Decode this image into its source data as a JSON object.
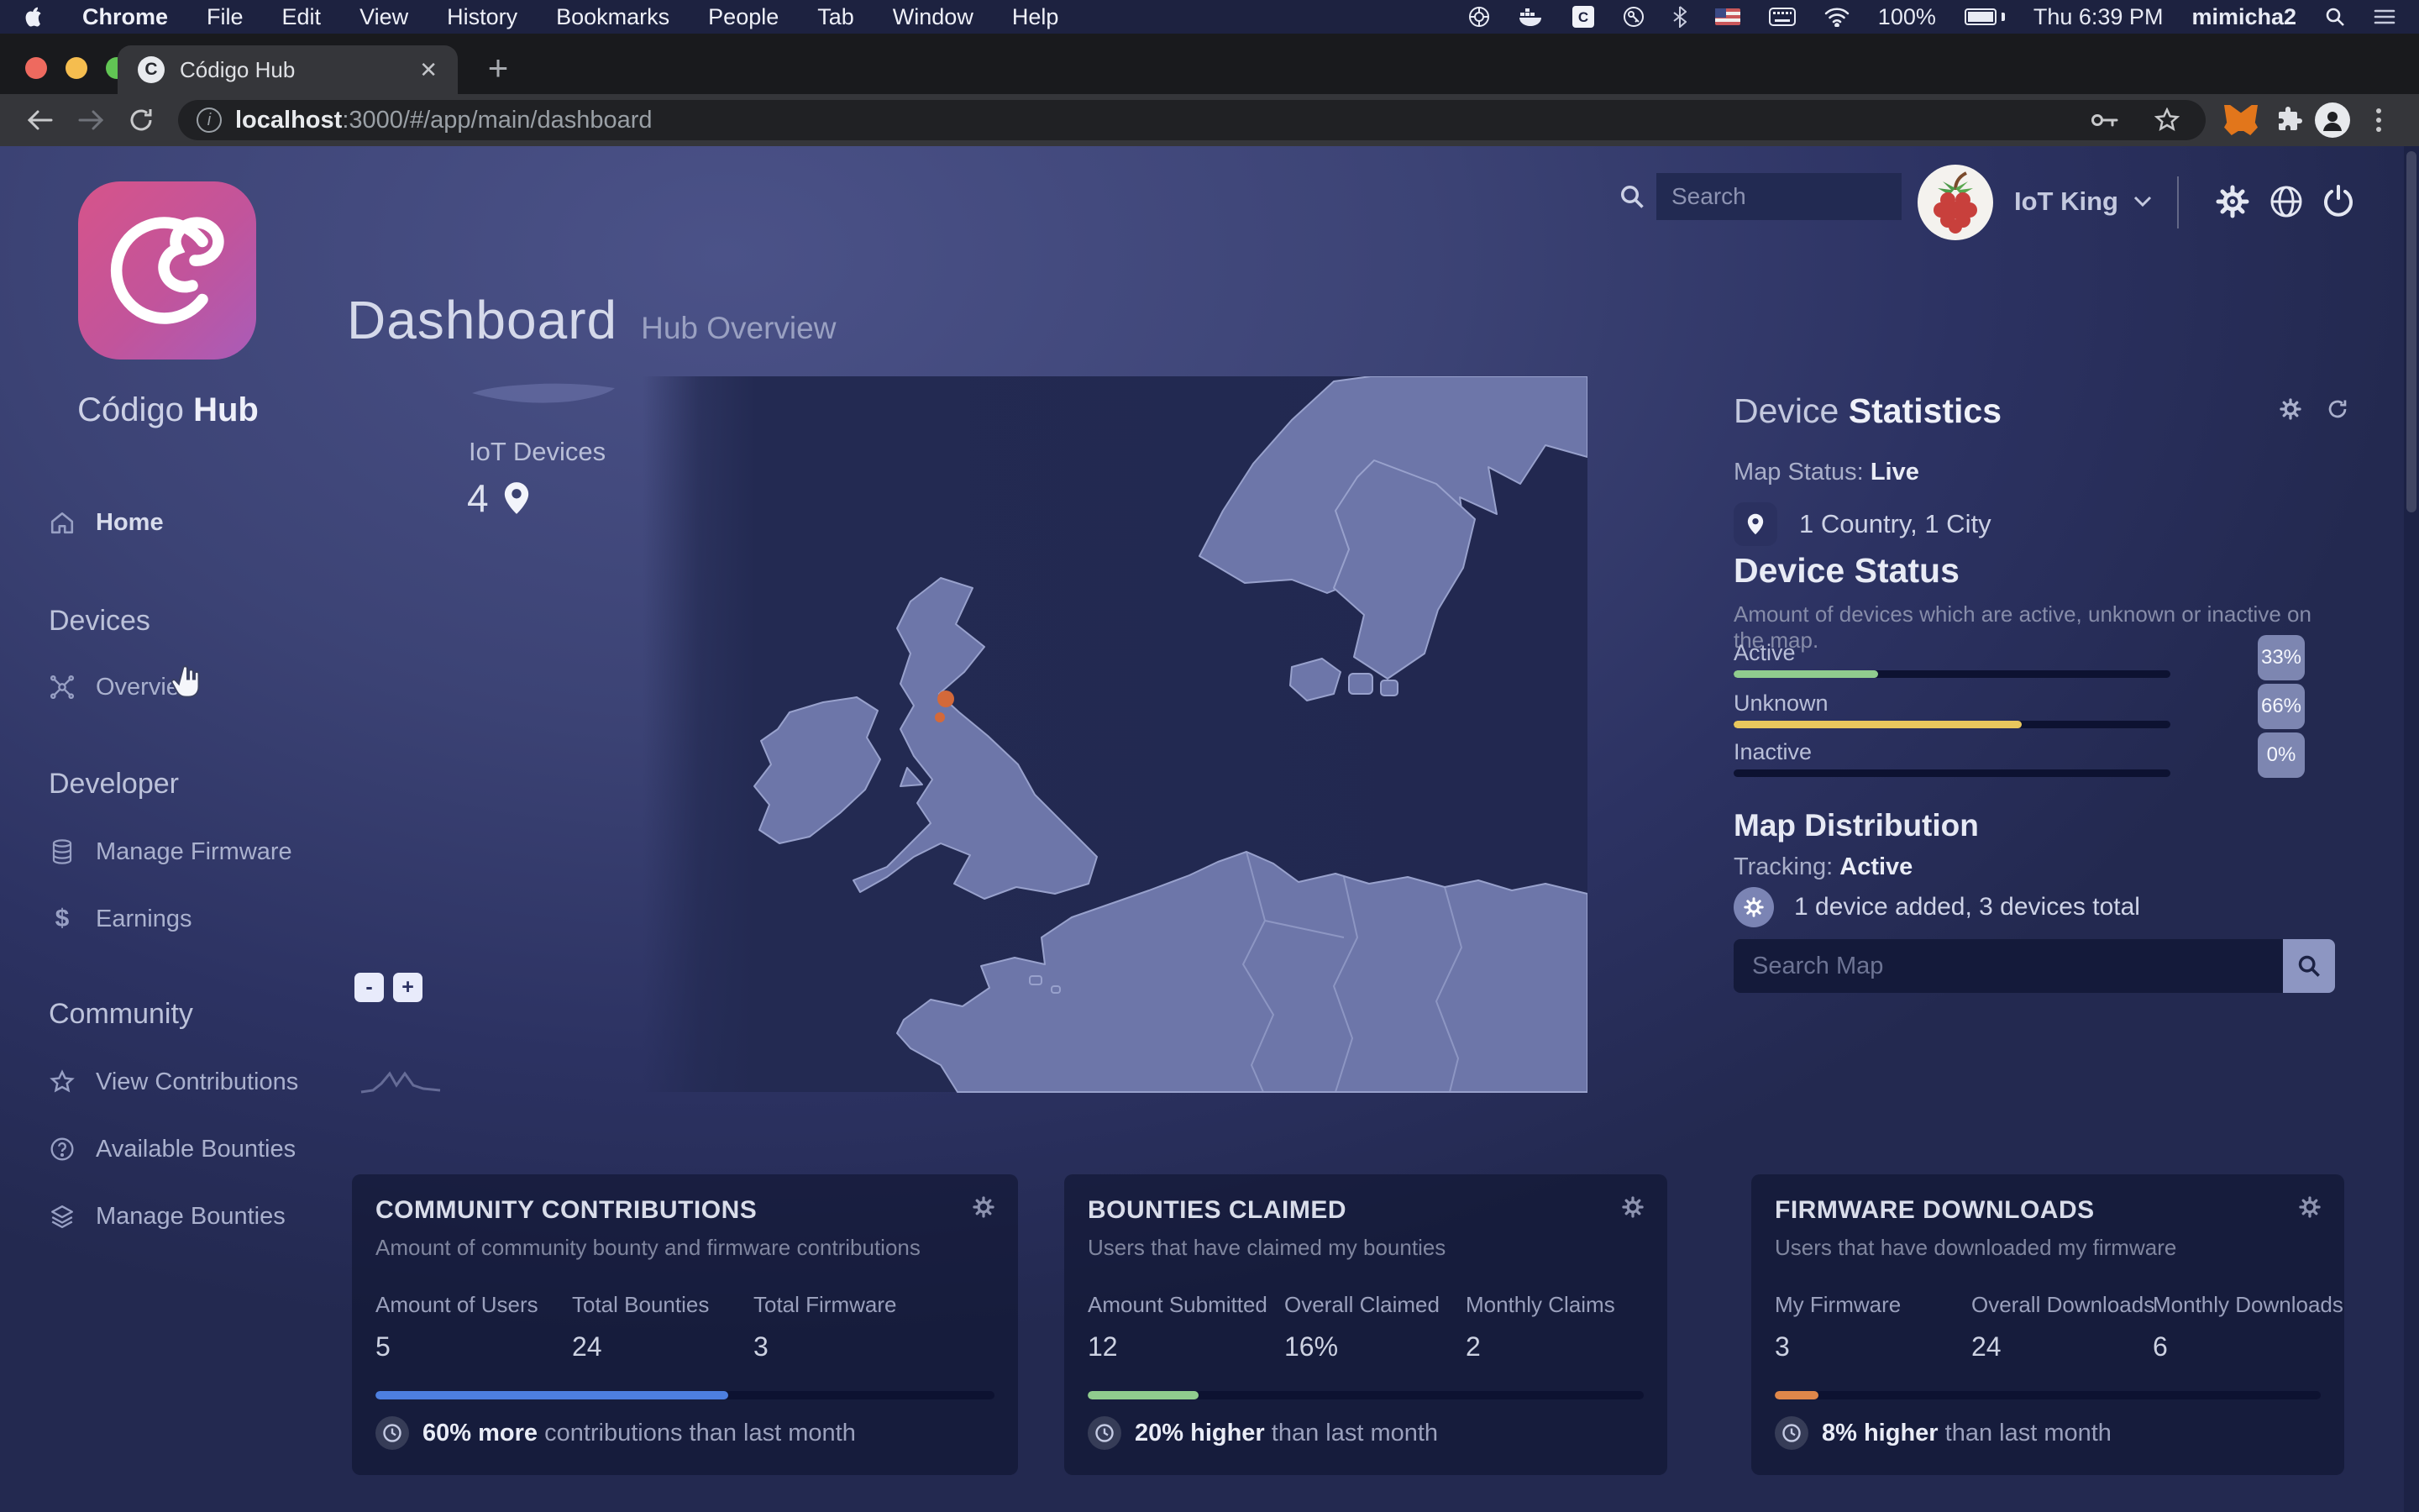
{
  "menu_bar": {
    "items": [
      "Chrome",
      "File",
      "Edit",
      "View",
      "History",
      "Bookmarks",
      "People",
      "Tab",
      "Window",
      "Help"
    ],
    "status": {
      "battery": "100%",
      "clock": "Thu 6:39 PM",
      "username": "mimicha2"
    }
  },
  "browser": {
    "tab_title": "Código Hub",
    "close_glyph": "✕",
    "new_tab_glyph": "+",
    "favicon_letter": "C",
    "url_host": "localhost",
    "url_rest": ":3000/#/app/main/dashboard"
  },
  "sidebar": {
    "brand_name": "Código",
    "brand_suffix": "Hub",
    "home_label": "Home",
    "sections": [
      {
        "header": "Devices",
        "items": [
          {
            "label": "Overview"
          }
        ]
      },
      {
        "header": "Developer",
        "items": [
          {
            "label": "Manage Firmware"
          },
          {
            "label": "Earnings"
          }
        ]
      },
      {
        "header": "Community",
        "items": [
          {
            "label": "View Contributions"
          },
          {
            "label": "Available Bounties"
          },
          {
            "label": "Manage Bounties"
          }
        ]
      }
    ]
  },
  "header": {
    "title": "Dashboard",
    "subtitle": "Hub Overview",
    "search_placeholder": "Search",
    "user_name": "IoT King"
  },
  "map": {
    "devices_label": "IoT Devices",
    "devices_count": "4",
    "zoom_out_label": "-",
    "zoom_in_label": "+"
  },
  "device_statistics": {
    "title_light": "Device",
    "title_bold": "Statistics",
    "map_status_label": "Map Status:",
    "map_status_value": "Live",
    "location_summary": "1 Country, 1 City",
    "device_status_title": "Device Status",
    "device_status_desc": "Amount of devices which are active, unknown or inactive on the map.",
    "rows": [
      {
        "label": "Active",
        "pct": 33,
        "pct_label": "33%",
        "color": "#90cc8e"
      },
      {
        "label": "Unknown",
        "pct": 66,
        "pct_label": "66%",
        "color": "#e9c75d"
      },
      {
        "label": "Inactive",
        "pct": 0,
        "pct_label": "0%",
        "color": "#e0874a"
      }
    ],
    "map_distribution_title": "Map Distribution",
    "tracking_label": "Tracking:",
    "tracking_value": "Active",
    "devices_added_text": "1 device added, 3 devices total",
    "map_search_placeholder": "Search Map"
  },
  "cards": [
    {
      "title": "COMMUNITY CONTRIBUTIONS",
      "subtitle": "Amount of community bounty and firmware contributions",
      "stats": [
        {
          "label": "Amount of Users",
          "value": "5"
        },
        {
          "label": "Total Bounties",
          "value": "24"
        },
        {
          "label": "Total Firmware",
          "value": "3"
        }
      ],
      "progress_pct": 57,
      "progress_color": "#4d7fe0",
      "footer_bold": "60% more",
      "footer_rest": " contributions than last month"
    },
    {
      "title": "BOUNTIES CLAIMED",
      "subtitle": "Users that have claimed my bounties",
      "stats": [
        {
          "label": "Amount Submitted",
          "value": "12"
        },
        {
          "label": "Overall Claimed",
          "value": "16%"
        },
        {
          "label": "Monthly Claims",
          "value": "2"
        }
      ],
      "progress_pct": 20,
      "progress_color": "#90cc8e",
      "footer_bold": "20% higher",
      "footer_rest": " than last month"
    },
    {
      "title": "FIRMWARE DOWNLOADS",
      "subtitle": "Users that have downloaded my firmware",
      "stats": [
        {
          "label": "My Firmware",
          "value": "3"
        },
        {
          "label": "Overall Downloads",
          "value": "24"
        },
        {
          "label": "Monthly Downloads",
          "value": "6"
        }
      ],
      "progress_pct": 8,
      "progress_color": "#e0874a",
      "footer_bold": "8% higher",
      "footer_rest": " than last month"
    }
  ],
  "colors": {
    "accent_blue": "#4d7fe0",
    "accent_green": "#90cc8e",
    "accent_yellow": "#e9c75d",
    "accent_orange": "#e0874a",
    "badge_bg": "#8d96c2",
    "logo_gradient_start": "#d6548a",
    "logo_gradient_end": "#a95cb8",
    "sea": "#232a52",
    "land": "#6d76a9"
  }
}
